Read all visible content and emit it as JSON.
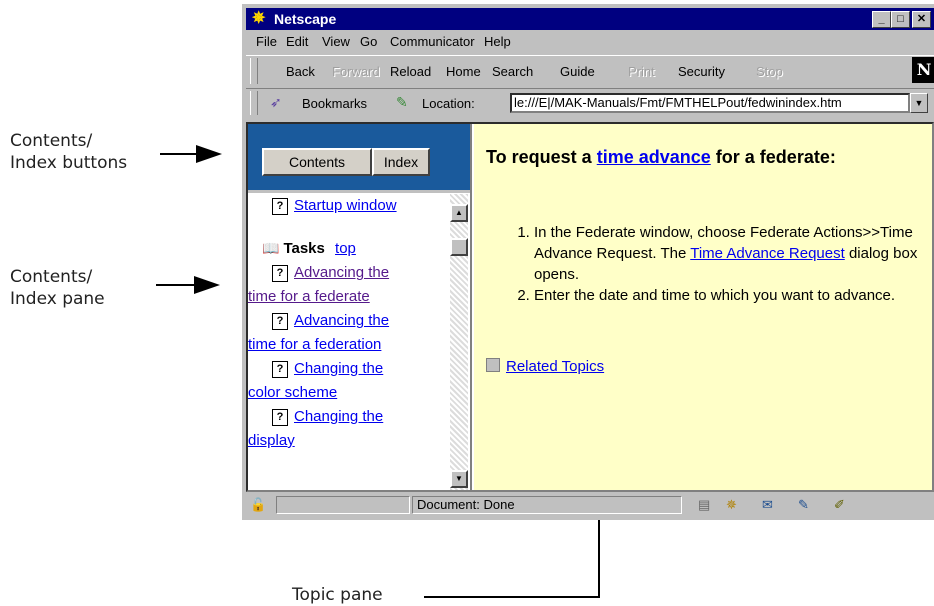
{
  "window": {
    "title": "Netscape",
    "controls": [
      "_",
      "□",
      "✕"
    ]
  },
  "menu": [
    "File",
    "Edit",
    "View",
    "Go",
    "Communicator",
    "Help"
  ],
  "toolbar": {
    "back": "Back",
    "forward": "Forward",
    "reload": "Reload",
    "home": "Home",
    "search": "Search",
    "guide": "Guide",
    "print": "Print",
    "security": "Security",
    "stop": "Stop",
    "logo": "N"
  },
  "location_bar": {
    "bookmarks": "Bookmarks",
    "location_label": "Location:",
    "url": "le:///E|/MAK-Manuals/Fmt/FMTHELPout/fedwinindex.htm"
  },
  "left_pane": {
    "contents_button": "Contents",
    "index_button": "Index",
    "startup_window": "Startup window",
    "tasks_heading": "Tasks",
    "top_link": "top",
    "items": [
      {
        "line1": "Advancing the",
        "line2": "time for a federate"
      },
      {
        "line1": "Advancing the",
        "line2": "time for a federation"
      },
      {
        "line1": "Changing the",
        "line2": "color scheme"
      },
      {
        "line1": "Changing the",
        "line2": "display"
      }
    ]
  },
  "topic": {
    "title_pre": "To request a",
    "title_link": "time advance",
    "title_post": "for a federate:",
    "step1_text": "In the Federate window, choose Federate Actions>>Time Advance Request. The",
    "step1_link": "Time Advance Request",
    "step1_post": "dialog box opens.",
    "step2": "Enter the date and time to which you want to advance.",
    "related": "Related Topics"
  },
  "status": {
    "text": "Document: Done"
  },
  "callouts": {
    "buttons_line1": "Contents/",
    "buttons_line2": "Index buttons",
    "pane_line1": "Contents/",
    "pane_line2": "Index pane",
    "topic": "Topic pane"
  }
}
